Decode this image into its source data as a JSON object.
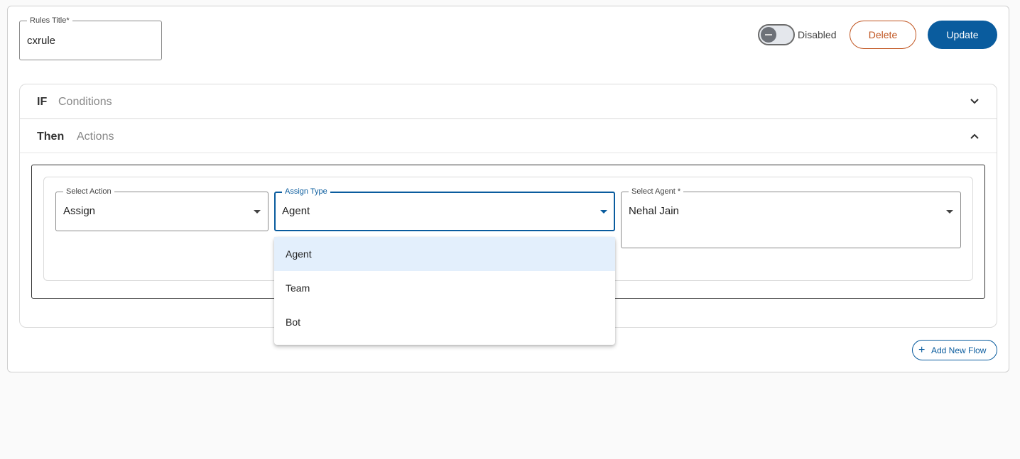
{
  "rule": {
    "title_label": "Rules Title*",
    "title_value": "cxrule",
    "status_label": "Disabled",
    "delete_label": "Delete",
    "update_label": "Update"
  },
  "accordion": {
    "if_key": "IF",
    "if_sub": "Conditions",
    "then_key": "Then",
    "then_sub": "Actions"
  },
  "action": {
    "select_action_label": "Select Action",
    "select_action_value": "Assign",
    "assign_type_label": "Assign Type",
    "assign_type_value": "Agent",
    "select_agent_label": "Select Agent *",
    "select_agent_value": "Nehal Jain"
  },
  "dropdown": {
    "options": [
      "Agent",
      "Team",
      "Bot"
    ],
    "selected": "Agent"
  },
  "add_flow_label": "Add New Flow",
  "colors": {
    "primary": "#0a5c9e",
    "danger": "#c0541f",
    "selected_option_bg": "#e3effc"
  },
  "icons": {
    "if_toggle": "chevron-down-icon",
    "then_toggle": "chevron-up-icon",
    "add": "plus-icon"
  }
}
